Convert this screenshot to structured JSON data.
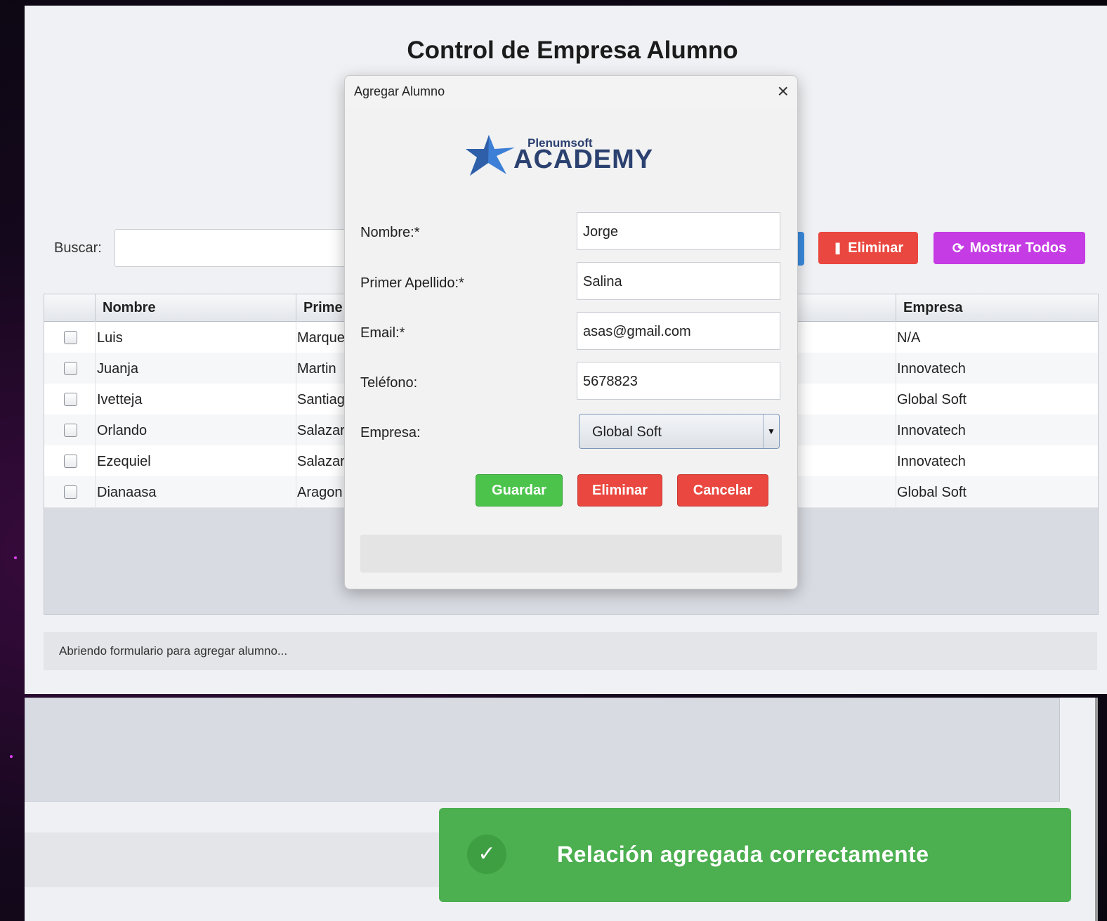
{
  "window": {
    "title": "Control de Empresa Alumno"
  },
  "search": {
    "label": "Buscar:",
    "value": ""
  },
  "toolbar": {
    "eliminar_label": "Eliminar",
    "mostrar_label": "Mostrar Todos"
  },
  "table": {
    "headers": [
      "Nombre",
      "Prime",
      "Empresa"
    ],
    "rows": [
      {
        "nombre": "Luis",
        "apellido": "Marque",
        "empresa": "N/A"
      },
      {
        "nombre": "Juanja",
        "apellido": "Martin",
        "empresa": "Innovatech"
      },
      {
        "nombre": "Ivetteja",
        "apellido": "Santiag",
        "empresa": "Global Soft"
      },
      {
        "nombre": "Orlando",
        "apellido": "Salazar",
        "empresa": "Innovatech"
      },
      {
        "nombre": "Ezequiel",
        "apellido": "Salazar",
        "empresa": "Innovatech"
      },
      {
        "nombre": "Dianaasa",
        "apellido": "Aragon",
        "empresa": "Global Soft"
      }
    ]
  },
  "status": {
    "text": "Abriendo formulario para agregar alumno..."
  },
  "dialog": {
    "title": "Agregar Alumno",
    "logo": {
      "small": "Plenumsoft",
      "big": "ACADEMY"
    },
    "fields": {
      "nombre_label": "Nombre:*",
      "nombre_value": "Jorge",
      "apellido_label": "Primer Apellido:*",
      "apellido_value": "Salina",
      "email_label": "Email:*",
      "email_value": "asas@gmail.com",
      "telefono_label": "Teléfono:",
      "telefono_value": "5678823",
      "empresa_label": "Empresa:",
      "empresa_value": "Global Soft"
    },
    "buttons": {
      "guardar": "Guardar",
      "eliminar": "Eliminar",
      "cancelar": "Cancelar"
    }
  },
  "toast": {
    "text": "Relación agregada correctamente"
  },
  "colors": {
    "green": "#4caf50",
    "red": "#e9473f",
    "purple": "#c53be4",
    "blue": "#3a8be0"
  },
  "icons": {
    "eliminar": "pause-bars-icon",
    "mostrar": "refresh-icon",
    "toast": "check-icon",
    "close": "close-icon"
  }
}
